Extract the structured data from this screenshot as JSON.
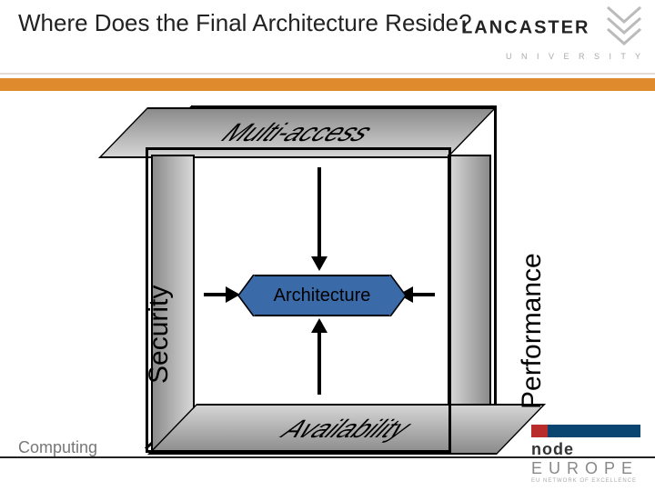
{
  "slide": {
    "title": "Where Does the Final Architecture Reside?"
  },
  "brand": {
    "name_strong": "LANCASTER",
    "name_light": "",
    "subline": "U N I V E R S I T Y"
  },
  "diagram": {
    "top": "Multi-access",
    "bottom": "Availability",
    "left": "Security",
    "right": "Performance",
    "center": "Architecture"
  },
  "footer": {
    "left": "Computing",
    "node_name": "node",
    "node_suffix": "EUROPE",
    "node_sub": "EU NETWORK OF EXCELLENCE"
  }
}
